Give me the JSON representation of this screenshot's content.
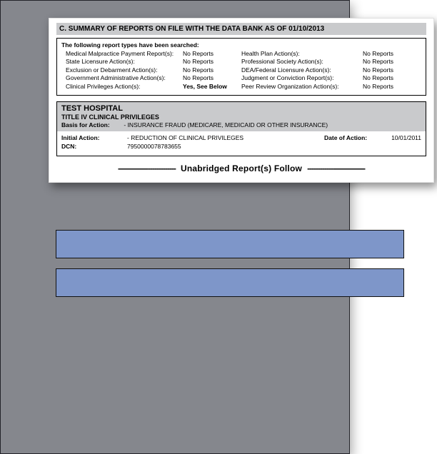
{
  "section_title": "C. SUMMARY OF REPORTS ON FILE WITH THE DATA BANK AS OF 01/10/2013",
  "search_intro": "The following report types have been searched:",
  "search_rows": [
    {
      "left_label": "Medical Malpractice Payment Report(s):",
      "left_value": "No Reports",
      "right_label": "Health Plan Action(s):",
      "right_value": "No Reports"
    },
    {
      "left_label": "State Licensure Action(s):",
      "left_value": "No Reports",
      "right_label": "Professional Society Action(s):",
      "right_value": "No Reports"
    },
    {
      "left_label": "Exclusion or Debarment Action(s):",
      "left_value": "No Reports",
      "right_label": "DEA/Federal Licensure Action(s):",
      "right_value": "No Reports"
    },
    {
      "left_label": "Government Administrative Action(s):",
      "left_value": "No Reports",
      "right_label": "Judgment or Conviction Report(s):",
      "right_value": "No Reports"
    },
    {
      "left_label": "Clinical Privileges Action(s):",
      "left_value": "Yes, See Below",
      "right_label": "Peer Review Organization Action(s):",
      "right_value": "No Reports",
      "left_bold": true
    }
  ],
  "hospital": {
    "name": "TEST HOSPITAL",
    "subtitle": "TITLE IV CLINICAL PRIVILEGES",
    "basis_label": "Basis for Action:",
    "basis_value": "- INSURANCE FRAUD (MEDICARE, MEDICAID OR OTHER INSURANCE)",
    "initial_action_label": "Initial Action:",
    "initial_action_value": "- REDUCTION OF CLINICAL PRIVILEGES",
    "date_label": "Date of Action:",
    "date_value": "10/01/2011",
    "dcn_label": "DCN:",
    "dcn_value": "7950000078783655"
  },
  "follow": {
    "dashes": "---------------------------",
    "text": "Unabridged Report(s) Follow"
  }
}
